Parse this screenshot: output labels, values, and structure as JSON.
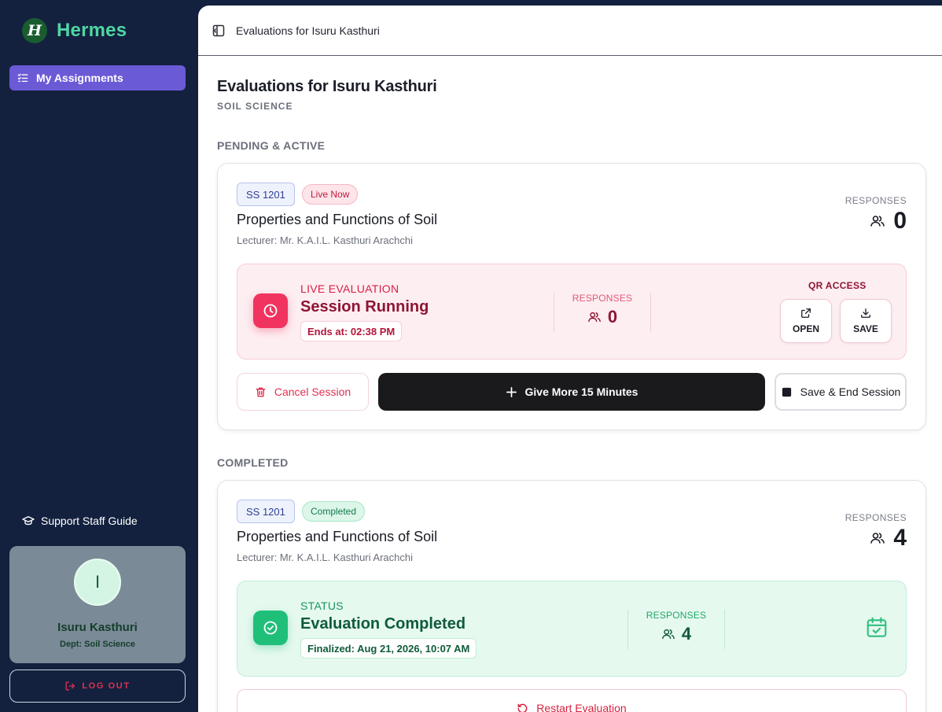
{
  "brand": {
    "logo_letter": "H",
    "name": "Hermes"
  },
  "sidebar": {
    "nav": [
      {
        "label": "My Assignments",
        "icon": "checklist-icon",
        "active": true
      }
    ],
    "guide_label": "Support Staff Guide",
    "profile": {
      "initial": "I",
      "name": "Isuru Kasthuri",
      "dept": "Dept: Soil Science"
    },
    "logout_label": "LOG OUT"
  },
  "topbar": {
    "title": "Evaluations for Isuru Kasthuri"
  },
  "page": {
    "title": "Evaluations for Isuru Kasthuri",
    "subtitle": "SOIL SCIENCE"
  },
  "sections": {
    "pending": "PENDING & ACTIVE",
    "completed": "COMPLETED"
  },
  "active_card": {
    "code": "SS 1201",
    "status": "Live Now",
    "title": "Properties and Functions of Soil",
    "lecturer": "Lecturer: Mr. K.A.I.L. Kasthuri Arachchi",
    "responses_label": "RESPONSES",
    "responses": "0",
    "panel": {
      "kicker": "LIVE EVALUATION",
      "heading": "Session Running",
      "pill": "Ends at: 02:38 PM",
      "responses_label": "RESPONSES",
      "responses": "0",
      "qr_label": "QR ACCESS",
      "open_label": "OPEN",
      "save_label": "SAVE"
    },
    "actions": {
      "cancel": "Cancel Session",
      "more": "Give More 15 Minutes",
      "end": "Save & End Session"
    }
  },
  "completed_card": {
    "code": "SS 1201",
    "status": "Completed",
    "title": "Properties and Functions of Soil",
    "lecturer": "Lecturer: Mr. K.A.I.L. Kasthuri Arachchi",
    "responses_label": "RESPONSES",
    "responses": "4",
    "panel": {
      "kicker": "STATUS",
      "heading": "Evaluation Completed",
      "pill": "Finalized: Aug 21, 2026, 10:07 AM",
      "responses_label": "RESPONSES",
      "responses": "4"
    },
    "actions": {
      "restart": "Restart Evaluation"
    }
  },
  "colors": {
    "sidebar_bg": "#13213f",
    "accent_purple": "#6b5ad6",
    "brand_green": "#4fd6a1",
    "live_red": "#f0345f",
    "done_green": "#1fbf7a"
  }
}
